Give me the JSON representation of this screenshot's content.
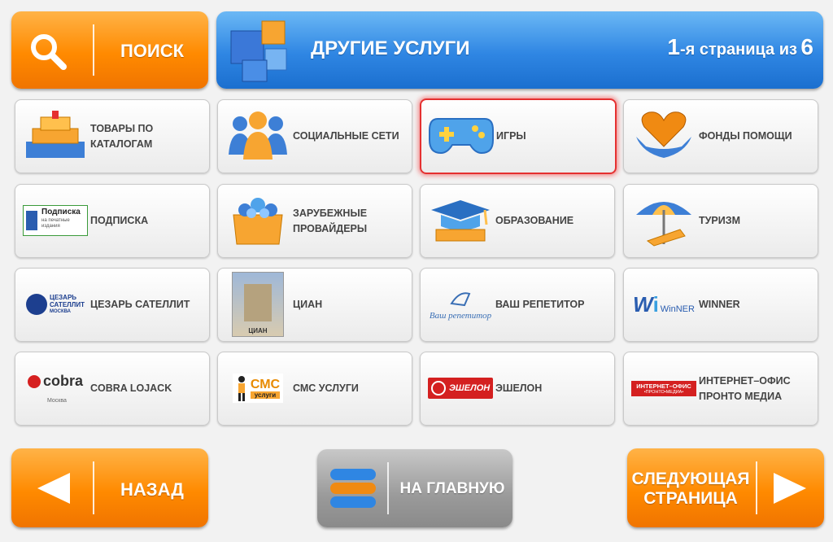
{
  "search": {
    "label": "ПОИСК",
    "icon": "search-icon"
  },
  "header": {
    "title": "ДРУГИЕ УСЛУГИ",
    "page_num": "1",
    "page_text": "-я страница из",
    "page_total": "6",
    "icon": "cubes-icon"
  },
  "tiles": [
    {
      "label": "ТОВАРЫ ПО КАТАЛОГАМ",
      "icon": "gift-boxes-icon"
    },
    {
      "label": "СОЦИАЛЬНЫЕ СЕТИ",
      "icon": "people-icon"
    },
    {
      "label": "ИГРЫ",
      "icon": "gamepad-icon"
    },
    {
      "label": "ФОНДЫ ПОМОЩИ",
      "icon": "heart-hands-icon"
    },
    {
      "label": "ПОДПИСКА",
      "icon": "podpiska-logo",
      "logo_title": "Подписка",
      "logo_sub": "на печатные издания"
    },
    {
      "label": "ЗАРУБЕЖНЫЕ ПРОВАЙДЕРЫ",
      "icon": "box-globes-icon"
    },
    {
      "label": "ОБРАЗОВАНИЕ",
      "icon": "graduation-cap-icon"
    },
    {
      "label": "ТУРИЗМ",
      "icon": "beach-umbrella-icon"
    },
    {
      "label": "ЦЕЗАРЬ САТЕЛЛИТ",
      "icon": "cesar-logo",
      "logo_line1": "ЦЕЗАРЬ",
      "logo_line2": "САТЕЛЛИТ",
      "logo_line3": "МОСКВА"
    },
    {
      "label": "ЦИАН",
      "icon": "cian-building-icon",
      "logo_caption": "ЦИАН"
    },
    {
      "label": "ВАШ РЕПЕТИТОР",
      "icon": "repetitor-logo",
      "logo_text": "Ваш репетитор"
    },
    {
      "label": "WINNER",
      "icon": "winner-logo",
      "logo_text": "WinNER"
    },
    {
      "label": "COBRA LOJACK",
      "icon": "cobra-logo",
      "logo_text": "cobra",
      "logo_sub": "Москва"
    },
    {
      "label": "СМС УСЛУГИ",
      "icon": "sms-logo",
      "logo_text": "СМС",
      "logo_sub": "услуги"
    },
    {
      "label": "ЭШЕЛОН",
      "icon": "eshelon-logo",
      "logo_text": "ЭШЕЛОН"
    },
    {
      "label": "ИНТЕРНЕТ–ОФИС ПРОНТО МЕДИА",
      "icon": "internet-office-logo",
      "logo_line1": "ИНТЕРНЕТ–ОФИС",
      "logo_line2": "•ПРОНТО•МЕДИА•"
    }
  ],
  "selected_tile": "ИГРЫ",
  "back": {
    "label": "НАЗАД",
    "icon": "arrow-left-icon"
  },
  "home": {
    "label": "НА ГЛАВНУЮ",
    "icon": "home-stack-icon"
  },
  "next": {
    "label_line1": "СЛЕДУЮЩАЯ",
    "label_line2": "СТРАНИЦА",
    "icon": "arrow-right-icon"
  },
  "colors": {
    "accent_orange": "#ff8a00",
    "header_blue": "#2f86e3",
    "selected_red": "#e53030"
  }
}
